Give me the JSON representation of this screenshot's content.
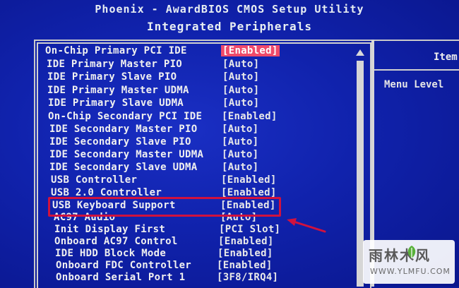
{
  "header": {
    "title": "Phoenix - AwardBIOS CMOS Setup Utility",
    "subtitle": "Integrated Peripherals"
  },
  "help": {
    "title": "Item",
    "text": "Menu Level"
  },
  "settings": [
    {
      "label": "On-Chip Primary   PCI IDE",
      "value": "[Enabled]",
      "selected": true
    },
    {
      "label": "IDE Primary Master PIO",
      "value": "[Auto]"
    },
    {
      "label": "IDE Primary Slave  PIO",
      "value": "[Auto]"
    },
    {
      "label": "IDE Primary Master UDMA",
      "value": "[Auto]"
    },
    {
      "label": "IDE Primary Slave  UDMA",
      "value": "[Auto]"
    },
    {
      "label": "On-Chip Secondary PCI IDE",
      "value": "[Enabled]"
    },
    {
      "label": "IDE Secondary Master PIO",
      "value": "[Auto]"
    },
    {
      "label": "IDE Secondary Slave  PIO",
      "value": "[Auto]"
    },
    {
      "label": "IDE Secondary Master UDMA",
      "value": "[Auto]"
    },
    {
      "label": "IDE Secondary Slave  UDMA",
      "value": "[Auto]"
    },
    {
      "label": "USB Controller",
      "value": "[Enabled]"
    },
    {
      "label": "USB 2.0 Controller",
      "value": "[Enabled]"
    },
    {
      "label": "USB Keyboard Support",
      "value": "[Enabled]",
      "highlighted": true
    },
    {
      "label": "AC97 Audio",
      "value": "[Auto]"
    },
    {
      "label": "Init Display First",
      "value": "[PCI Slot]"
    },
    {
      "label": "Onboard AC97 Control",
      "value": "[Enabled]"
    },
    {
      "label": "IDE HDD Block Mode",
      "value": "[Enabled]"
    },
    {
      "label": "Onboard FDC Controller",
      "value": "[Enabled]"
    },
    {
      "label": "Onboard Serial Port 1",
      "value": "[3F8/IRQ4]"
    }
  ],
  "watermark": {
    "logo": "雨林木风",
    "url": "WWW.YLMFU.COM"
  },
  "colors": {
    "background": "#1022ac",
    "selected_value": "#f04a6a",
    "highlight_box": "#d0123e",
    "text": "#f0f0f0"
  }
}
